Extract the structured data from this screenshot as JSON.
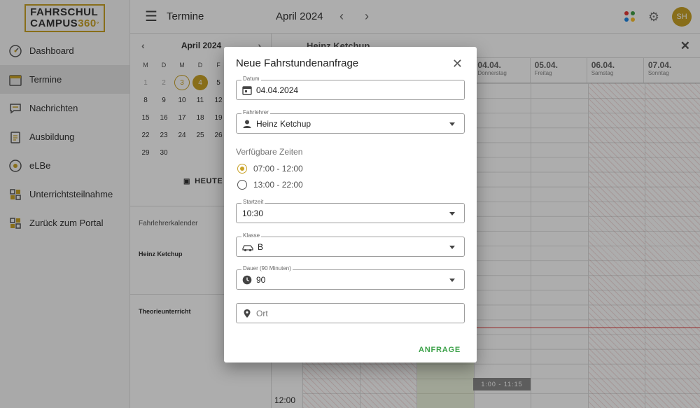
{
  "brand": {
    "line1": "FAHRSCHUL",
    "line2": "CAMPUS",
    "line2_accent": "360",
    "degree": "°",
    "accent_color": "#c9a227"
  },
  "sidebar": {
    "items": [
      {
        "label": "Dashboard",
        "icon": "speedometer-icon"
      },
      {
        "label": "Termine",
        "icon": "calendar-icon",
        "active": true
      },
      {
        "label": "Nachrichten",
        "icon": "chat-icon"
      },
      {
        "label": "Ausbildung",
        "icon": "clipboard-icon"
      },
      {
        "label": "eLBe",
        "icon": "steering-wheel-icon"
      },
      {
        "label": "Unterrichtsteilnahme",
        "icon": "qr-icon"
      },
      {
        "label": "Zurück zum Portal",
        "icon": "apps-grid-icon"
      }
    ]
  },
  "topbar": {
    "title": "Termine",
    "month": "April 2024",
    "avatar": "SH"
  },
  "mini_calendar": {
    "month": "April 2024",
    "weekdays": [
      "M",
      "D",
      "M",
      "D",
      "F"
    ],
    "rows": [
      [
        "1",
        "2",
        "3",
        "4",
        "5"
      ],
      [
        "8",
        "9",
        "10",
        "11",
        "12"
      ],
      [
        "15",
        "16",
        "17",
        "18",
        "19"
      ],
      [
        "22",
        "23",
        "24",
        "25",
        "26"
      ],
      [
        "29",
        "30"
      ]
    ],
    "today_label": "HEUTE",
    "section_label": "Fahrlehrerkalender",
    "instructor": "Heinz Ketchup",
    "theory": "Theorieunterricht"
  },
  "calendar": {
    "resource": "Heinz Ketchup",
    "days": [
      {
        "date": "04.04.",
        "label": "Donnerstag"
      },
      {
        "date": "05.04.",
        "label": "Freitag"
      },
      {
        "date": "06.04.",
        "label": "Samstag"
      },
      {
        "date": "07.04.",
        "label": "Sonntag"
      }
    ],
    "event_time": "1:00 - 11:15",
    "time_label": "12:00"
  },
  "dialog": {
    "title": "Neue Fahrstundenanfrage",
    "datum": {
      "label": "Datum",
      "value": "04.04.2024"
    },
    "fahrlehrer": {
      "label": "Fahrlehrer",
      "value": "Heinz Ketchup"
    },
    "available_label": "Verfügbare Zeiten",
    "slots": [
      {
        "label": "07:00 - 12:00",
        "selected": true
      },
      {
        "label": "13:00 - 22:00",
        "selected": false
      }
    ],
    "startzeit": {
      "label": "Startzeit",
      "value": "10:30"
    },
    "klasse": {
      "label": "Klasse",
      "value": "B"
    },
    "dauer": {
      "label": "Dauer (90 Minuten)",
      "value": "90"
    },
    "ort": {
      "placeholder": "Ort"
    },
    "submit": "ANFRAGE",
    "submit_color": "#3da24a"
  }
}
